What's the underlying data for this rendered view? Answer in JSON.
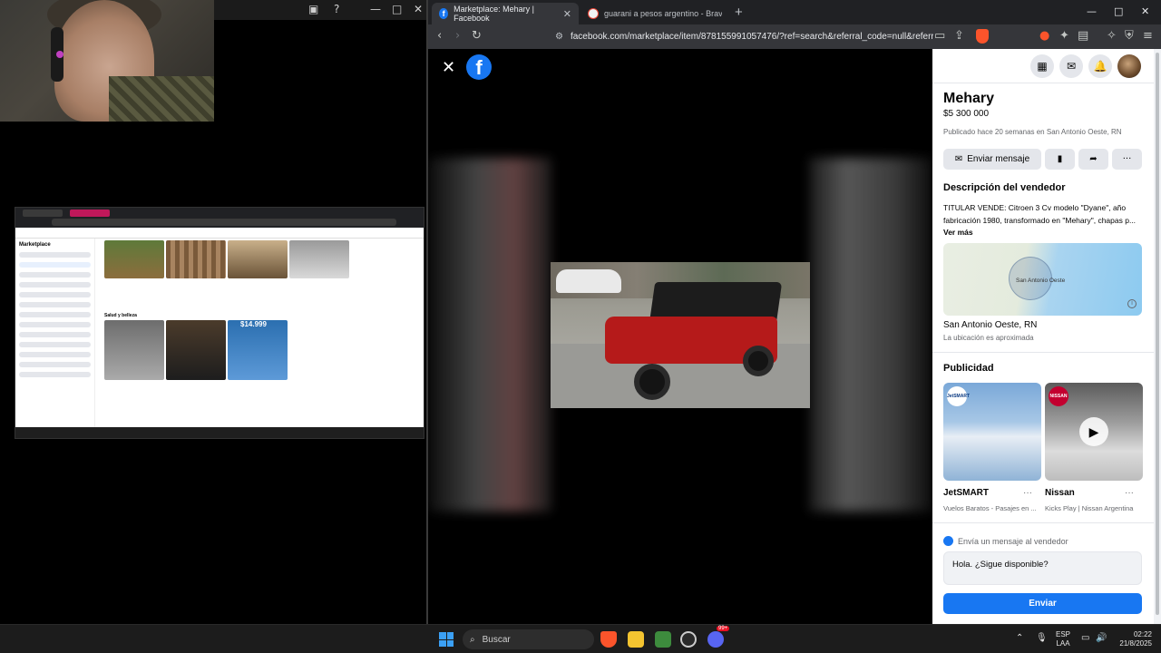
{
  "browser": {
    "tabs": [
      {
        "label": "Marketplace: Mehary | Facebook",
        "favicon": "facebook-icon",
        "active": true
      },
      {
        "label": "guarani a pesos argentino - Brave Se",
        "favicon": "brave-search-icon",
        "active": false
      }
    ],
    "url": "facebook.com/marketplace/item/878155991057476/?ref=search&referral_code=null&referr..."
  },
  "listing": {
    "title": "Mehary",
    "price": "$5 300 000",
    "published": "Publicado hace 20 semanas en San Antonio Oeste, RN",
    "message_button": "Enviar mensaje",
    "description_heading": "Descripción del vendedor",
    "description": "TITULAR VENDE: Citroen 3 Cv modelo \"Dyane\", año fabricación 1980, transformado en \"Mehary\", chapas p...",
    "see_more": "Ver más",
    "map_label": "San Antonio Oeste",
    "location": "San Antonio Oeste, RN",
    "location_note": "La ubicación es aproximada"
  },
  "ads": {
    "heading": "Publicidad",
    "items": [
      {
        "name": "JetSMART",
        "subtitle": "Vuelos Baratos - Pasajes en ...",
        "badge": "JetSMART"
      },
      {
        "name": "Nissan",
        "subtitle": "Kicks Play | Nissan Argentina",
        "badge": "NISSAN"
      }
    ]
  },
  "message": {
    "prompt": "Envía un mensaje al vendedor",
    "input_value": "Hola. ¿Sigue disponible?",
    "send_label": "Enviar"
  },
  "mini_screen": {
    "marketplace_title": "Marketplace",
    "price_tag": "$14.999",
    "section": "Salud y belleza"
  },
  "taskbar": {
    "search_label": "Buscar",
    "lang_top": "ESP",
    "lang_bottom": "LAA",
    "time": "02:22",
    "date": "21/8/2025",
    "notification_badge": "99+"
  },
  "colors": {
    "facebook_blue": "#1877f2",
    "brave_orange": "#fb542b"
  }
}
